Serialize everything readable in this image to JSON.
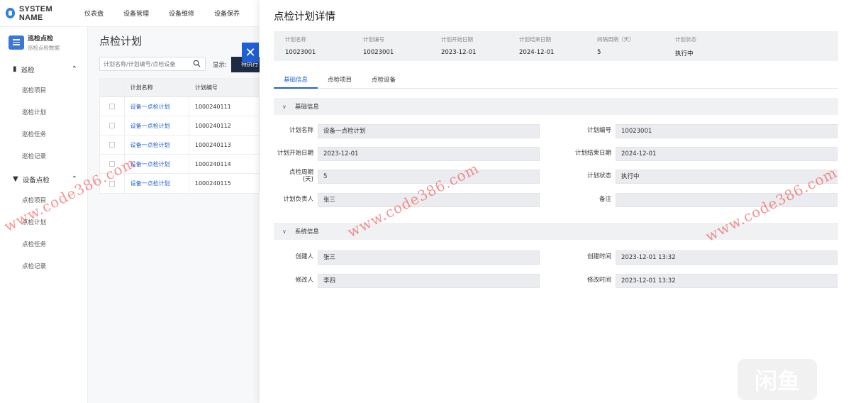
{
  "app": {
    "name": "SYSTEM NAME"
  },
  "nav": [
    "仪表盘",
    "设备管理",
    "设备维修",
    "设备保养"
  ],
  "sidebar": {
    "module": {
      "title": "巡检点检",
      "subtitle": "巡检点检数据"
    },
    "groups": [
      {
        "label": "巡检",
        "items": [
          "巡检项目",
          "巡检计划",
          "巡检任务",
          "巡检记录"
        ]
      },
      {
        "label": "设备点检",
        "items": [
          "点检项目",
          "点检计划",
          "点检任务",
          "点检记录"
        ]
      }
    ]
  },
  "list": {
    "title": "点检计划",
    "search_placeholder": "计划名称/计划编号/点检设备",
    "show_label": "显示:",
    "status_button": "待执行",
    "columns": [
      "计划名称",
      "计划编号"
    ],
    "rows": [
      {
        "name": "设备一点检计划",
        "code": "1000240111"
      },
      {
        "name": "设备一点检计划",
        "code": "1000240112"
      },
      {
        "name": "设备一点检计划",
        "code": "1000240113"
      },
      {
        "name": "设备一点检计划",
        "code": "1000240114"
      },
      {
        "name": "设备一点检计划",
        "code": "1000240115"
      }
    ]
  },
  "detail": {
    "title": "点检计划详情",
    "summary": [
      {
        "label": "计划名称",
        "value": "10023001"
      },
      {
        "label": "计划编号",
        "value": "10023001"
      },
      {
        "label": "计划开始日期",
        "value": "2023-12-01"
      },
      {
        "label": "计划结束日期",
        "value": "2024-12-01"
      },
      {
        "label": "间隔周期（天）",
        "value": "5"
      },
      {
        "label": "计划状态",
        "value": "执行中"
      }
    ],
    "tabs": [
      "基础信息",
      "点检项目",
      "点检设备"
    ],
    "basic_section": "基础信息",
    "basic": {
      "plan_name_label": "计划名称",
      "plan_name": "设备一点检计划",
      "plan_code_label": "计划编号",
      "plan_code": "10023001",
      "start_label": "计划开始日期",
      "start": "2023-12-01",
      "end_label": "计划结束日期",
      "end": "2024-12-01",
      "period_label": "点检周期\n(天)",
      "period": "5",
      "status_label": "计划状态",
      "status": "执行中",
      "owner_label": "计划负责人",
      "owner": "张三",
      "remark_label": "备注",
      "remark": ""
    },
    "system_section": "系统信息",
    "system": {
      "creator_label": "创建人",
      "creator": "张三",
      "created_label": "创建时间",
      "created": "2023-12-01 13:32",
      "modifier_label": "修改人",
      "modifier": "李四",
      "modified_label": "修改时间",
      "modified": "2023-12-01 13:32"
    }
  },
  "watermark": "www.code386.com",
  "badge": "闲鱼",
  "colors": {
    "accent": "#1f5fd6",
    "dark_button": "#1f2a44",
    "watermark": "#f03c3c"
  }
}
